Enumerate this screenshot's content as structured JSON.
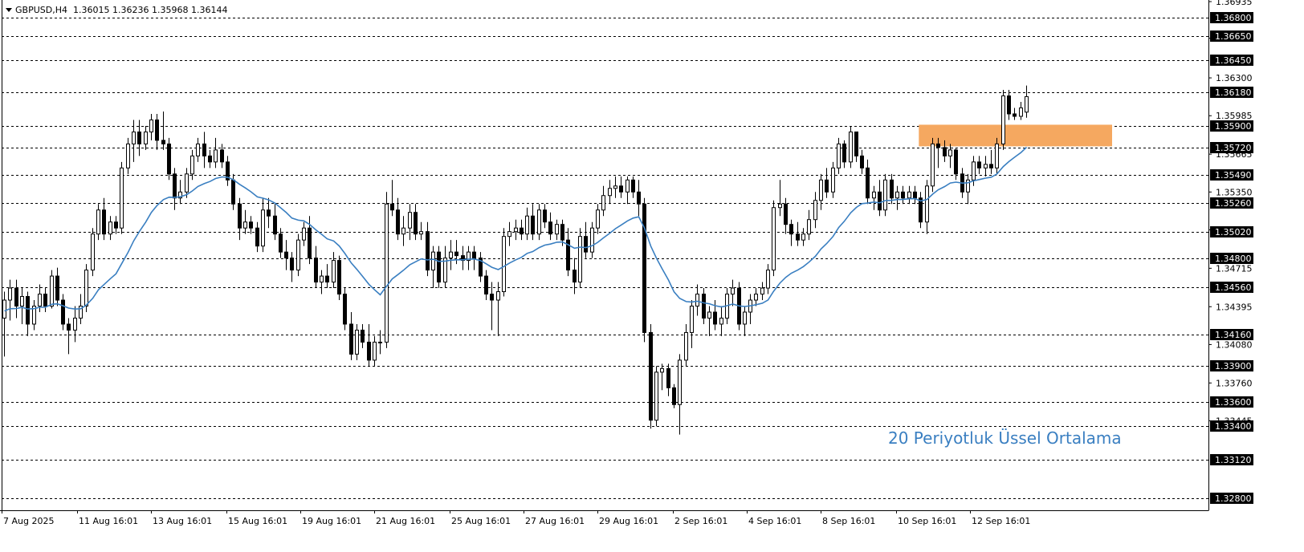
{
  "header": {
    "symbol": "GBPUSD,H4",
    "ohlc": "1.36015 1.36236 1.35968 1.36144"
  },
  "annotation": {
    "ema_label": "20 Periyotluk Üssel Ortalama",
    "ema_color": "#3a7fc1",
    "zone_color": "#f5a860"
  },
  "colors": {
    "background": "#ffffff",
    "candle_up": "#ffffff",
    "candle_down": "#000000",
    "candle_outline": "#000000",
    "level_line": "#000000",
    "price_tag_bg": "#000000",
    "price_tag_text": "#ffffff"
  },
  "chart_data": {
    "type": "candlestick",
    "symbol": "GBPUSD",
    "timeframe": "H4",
    "ylim": [
      1.327,
      1.36935
    ],
    "price_scale_labels": [
      "1.36935",
      "1.36630",
      "1.36300",
      "1.35985",
      "1.35665",
      "1.35350",
      "1.35035",
      "1.34715",
      "1.34395",
      "1.34080",
      "1.33760",
      "1.33445"
    ],
    "horizontal_levels": [
      "1.36800",
      "1.36650",
      "1.36450",
      "1.36180",
      "1.35900",
      "1.35720",
      "1.35490",
      "1.35260",
      "1.35020",
      "1.34800",
      "1.34560",
      "1.34160",
      "1.33900",
      "1.33600",
      "1.33400",
      "1.33120",
      "1.32800"
    ],
    "x_tick_labels": [
      "7 Aug 2025",
      "11 Aug 16:01",
      "13 Aug 16:01",
      "15 Aug 16:01",
      "19 Aug 16:01",
      "21 Aug 16:01",
      "25 Aug 16:01",
      "27 Aug 16:01",
      "29 Aug 16:01",
      "2 Sep 16:01",
      "4 Sep 16:01",
      "8 Sep 16:01",
      "10 Sep 16:01",
      "12 Sep 16:01"
    ],
    "zone": {
      "low": 1.3573,
      "high": 1.3591
    },
    "ema_period": 20,
    "ohlc": [
      [
        1.343,
        1.3452,
        1.3398,
        1.3445
      ],
      [
        1.3445,
        1.3462,
        1.3428,
        1.3455
      ],
      [
        1.3455,
        1.3462,
        1.343,
        1.344
      ],
      [
        1.344,
        1.3455,
        1.3425,
        1.3448
      ],
      [
        1.3448,
        1.3452,
        1.3415,
        1.3425
      ],
      [
        1.3425,
        1.3445,
        1.342,
        1.344
      ],
      [
        1.344,
        1.3458,
        1.3435,
        1.345
      ],
      [
        1.345,
        1.3455,
        1.3435,
        1.344
      ],
      [
        1.344,
        1.347,
        1.3438,
        1.3465
      ],
      [
        1.3465,
        1.3472,
        1.344,
        1.3445
      ],
      [
        1.3445,
        1.345,
        1.342,
        1.3425
      ],
      [
        1.3425,
        1.343,
        1.34,
        1.342
      ],
      [
        1.342,
        1.344,
        1.341,
        1.343
      ],
      [
        1.343,
        1.345,
        1.3425,
        1.344
      ],
      [
        1.344,
        1.3475,
        1.3435,
        1.347
      ],
      [
        1.347,
        1.3505,
        1.3465,
        1.35
      ],
      [
        1.35,
        1.3525,
        1.3495,
        1.352
      ],
      [
        1.352,
        1.353,
        1.3495,
        1.35
      ],
      [
        1.35,
        1.3515,
        1.3495,
        1.351
      ],
      [
        1.351,
        1.3515,
        1.35,
        1.3505
      ],
      [
        1.3505,
        1.356,
        1.35,
        1.3555
      ],
      [
        1.3555,
        1.358,
        1.355,
        1.3575
      ],
      [
        1.3575,
        1.3595,
        1.356,
        1.3585
      ],
      [
        1.3585,
        1.3595,
        1.3565,
        1.3575
      ],
      [
        1.3575,
        1.359,
        1.357,
        1.3585
      ],
      [
        1.3585,
        1.36,
        1.3578,
        1.3595
      ],
      [
        1.3595,
        1.36,
        1.357,
        1.3578
      ],
      [
        1.3578,
        1.3602,
        1.357,
        1.3575
      ],
      [
        1.3575,
        1.358,
        1.3545,
        1.355
      ],
      [
        1.355,
        1.3555,
        1.352,
        1.353
      ],
      [
        1.353,
        1.3545,
        1.3525,
        1.3535
      ],
      [
        1.3535,
        1.3555,
        1.353,
        1.355
      ],
      [
        1.355,
        1.357,
        1.3545,
        1.3565
      ],
      [
        1.3565,
        1.358,
        1.356,
        1.3575
      ],
      [
        1.3575,
        1.3585,
        1.3555,
        1.3565
      ],
      [
        1.3565,
        1.357,
        1.3555,
        1.356
      ],
      [
        1.356,
        1.358,
        1.3555,
        1.357
      ],
      [
        1.357,
        1.3575,
        1.3555,
        1.356
      ],
      [
        1.356,
        1.3565,
        1.354,
        1.3545
      ],
      [
        1.3545,
        1.355,
        1.352,
        1.3525
      ],
      [
        1.3525,
        1.353,
        1.3495,
        1.3505
      ],
      [
        1.3505,
        1.352,
        1.35,
        1.351
      ],
      [
        1.351,
        1.3515,
        1.35,
        1.3505
      ],
      [
        1.3505,
        1.351,
        1.3485,
        1.349
      ],
      [
        1.349,
        1.353,
        1.3485,
        1.352
      ],
      [
        1.352,
        1.353,
        1.3505,
        1.3515
      ],
      [
        1.3515,
        1.3525,
        1.3495,
        1.35
      ],
      [
        1.35,
        1.3505,
        1.348,
        1.3485
      ],
      [
        1.3485,
        1.3495,
        1.347,
        1.348
      ],
      [
        1.348,
        1.3485,
        1.346,
        1.347
      ],
      [
        1.347,
        1.35,
        1.3465,
        1.3495
      ],
      [
        1.3495,
        1.351,
        1.349,
        1.3505
      ],
      [
        1.3505,
        1.3515,
        1.3475,
        1.348
      ],
      [
        1.348,
        1.349,
        1.3455,
        1.346
      ],
      [
        1.346,
        1.347,
        1.345,
        1.3465
      ],
      [
        1.3465,
        1.3475,
        1.3455,
        1.346
      ],
      [
        1.346,
        1.3485,
        1.3455,
        1.3478
      ],
      [
        1.3478,
        1.3482,
        1.3445,
        1.345
      ],
      [
        1.345,
        1.3455,
        1.342,
        1.3425
      ],
      [
        1.3425,
        1.3435,
        1.3395,
        1.34
      ],
      [
        1.34,
        1.3425,
        1.3395,
        1.342
      ],
      [
        1.342,
        1.3425,
        1.3405,
        1.341
      ],
      [
        1.341,
        1.3425,
        1.339,
        1.3395
      ],
      [
        1.3395,
        1.3415,
        1.339,
        1.341
      ],
      [
        1.341,
        1.342,
        1.34,
        1.341
      ],
      [
        1.341,
        1.3535,
        1.3405,
        1.3525
      ],
      [
        1.3525,
        1.3545,
        1.3515,
        1.352
      ],
      [
        1.352,
        1.353,
        1.3495,
        1.35
      ],
      [
        1.35,
        1.3515,
        1.349,
        1.3505
      ],
      [
        1.3505,
        1.3525,
        1.3495,
        1.3518
      ],
      [
        1.3518,
        1.3525,
        1.3495,
        1.35
      ],
      [
        1.35,
        1.351,
        1.3495,
        1.3502
      ],
      [
        1.3502,
        1.351,
        1.3465,
        1.347
      ],
      [
        1.347,
        1.349,
        1.3455,
        1.3485
      ],
      [
        1.3485,
        1.349,
        1.3455,
        1.346
      ],
      [
        1.346,
        1.349,
        1.3455,
        1.348
      ],
      [
        1.348,
        1.3495,
        1.347,
        1.3485
      ],
      [
        1.3485,
        1.3495,
        1.3475,
        1.3482
      ],
      [
        1.3482,
        1.349,
        1.347,
        1.3478
      ],
      [
        1.3478,
        1.349,
        1.347,
        1.3485
      ],
      [
        1.3485,
        1.349,
        1.347,
        1.348
      ],
      [
        1.348,
        1.3485,
        1.346,
        1.3465
      ],
      [
        1.3465,
        1.347,
        1.3445,
        1.345
      ],
      [
        1.345,
        1.346,
        1.342,
        1.3445
      ],
      [
        1.3445,
        1.346,
        1.3415,
        1.3452
      ],
      [
        1.3452,
        1.3505,
        1.3448,
        1.3498
      ],
      [
        1.3498,
        1.351,
        1.349,
        1.3502
      ],
      [
        1.3502,
        1.3512,
        1.3495,
        1.3505
      ],
      [
        1.3505,
        1.3512,
        1.3495,
        1.35
      ],
      [
        1.35,
        1.3522,
        1.3495,
        1.3515
      ],
      [
        1.3515,
        1.3525,
        1.3495,
        1.35
      ],
      [
        1.35,
        1.3525,
        1.3495,
        1.352
      ],
      [
        1.352,
        1.3525,
        1.3505,
        1.351
      ],
      [
        1.351,
        1.3518,
        1.3495,
        1.35
      ],
      [
        1.35,
        1.3512,
        1.3495,
        1.3508
      ],
      [
        1.3508,
        1.3512,
        1.349,
        1.3495
      ],
      [
        1.3495,
        1.3505,
        1.3465,
        1.347
      ],
      [
        1.347,
        1.348,
        1.345,
        1.346
      ],
      [
        1.346,
        1.3505,
        1.3455,
        1.3498
      ],
      [
        1.3498,
        1.351,
        1.348,
        1.3485
      ],
      [
        1.3485,
        1.351,
        1.348,
        1.3505
      ],
      [
        1.3505,
        1.3525,
        1.35,
        1.352
      ],
      [
        1.352,
        1.354,
        1.3515,
        1.3532
      ],
      [
        1.3532,
        1.3545,
        1.3525,
        1.3538
      ],
      [
        1.3538,
        1.3548,
        1.353,
        1.354
      ],
      [
        1.354,
        1.3548,
        1.353,
        1.3535
      ],
      [
        1.3535,
        1.3548,
        1.3525,
        1.3545
      ],
      [
        1.3545,
        1.3548,
        1.353,
        1.3535
      ],
      [
        1.3535,
        1.3545,
        1.3515,
        1.3525
      ],
      [
        1.3525,
        1.353,
        1.341,
        1.3418
      ],
      [
        1.3418,
        1.3425,
        1.3338,
        1.3345
      ],
      [
        1.3345,
        1.339,
        1.334,
        1.3385
      ],
      [
        1.3385,
        1.3392,
        1.337,
        1.3388
      ],
      [
        1.3388,
        1.3392,
        1.3365,
        1.3372
      ],
      [
        1.3372,
        1.3375,
        1.3355,
        1.3358
      ],
      [
        1.3358,
        1.34,
        1.3333,
        1.3395
      ],
      [
        1.3395,
        1.3425,
        1.339,
        1.3418
      ],
      [
        1.3418,
        1.3445,
        1.3405,
        1.344
      ],
      [
        1.344,
        1.3458,
        1.3432,
        1.345
      ],
      [
        1.345,
        1.3455,
        1.3425,
        1.343
      ],
      [
        1.343,
        1.344,
        1.3415,
        1.3435
      ],
      [
        1.3435,
        1.3445,
        1.342,
        1.3425
      ],
      [
        1.3425,
        1.344,
        1.3415,
        1.343
      ],
      [
        1.343,
        1.3455,
        1.3425,
        1.345
      ],
      [
        1.345,
        1.3462,
        1.344,
        1.3455
      ],
      [
        1.3455,
        1.346,
        1.342,
        1.3425
      ],
      [
        1.3425,
        1.344,
        1.3415,
        1.3435
      ],
      [
        1.3435,
        1.345,
        1.3425,
        1.3445
      ],
      [
        1.3445,
        1.3455,
        1.344,
        1.345
      ],
      [
        1.345,
        1.346,
        1.3445,
        1.3455
      ],
      [
        1.3455,
        1.3475,
        1.345,
        1.347
      ],
      [
        1.347,
        1.3528,
        1.3465,
        1.3522
      ],
      [
        1.3522,
        1.3545,
        1.3515,
        1.3525
      ],
      [
        1.3525,
        1.353,
        1.35,
        1.3508
      ],
      [
        1.3508,
        1.3512,
        1.349,
        1.35
      ],
      [
        1.35,
        1.351,
        1.349,
        1.3495
      ],
      [
        1.3495,
        1.3505,
        1.349,
        1.35
      ],
      [
        1.35,
        1.352,
        1.3495,
        1.3512
      ],
      [
        1.3512,
        1.3535,
        1.3505,
        1.3528
      ],
      [
        1.3528,
        1.355,
        1.352,
        1.3545
      ],
      [
        1.3545,
        1.3555,
        1.353,
        1.3535
      ],
      [
        1.3535,
        1.356,
        1.353,
        1.3555
      ],
      [
        1.3555,
        1.358,
        1.355,
        1.3575
      ],
      [
        1.3575,
        1.3578,
        1.3555,
        1.356
      ],
      [
        1.356,
        1.359,
        1.3555,
        1.3585
      ],
      [
        1.3585,
        1.3585,
        1.356,
        1.3565
      ],
      [
        1.3565,
        1.357,
        1.355,
        1.3555
      ],
      [
        1.3555,
        1.3562,
        1.3525,
        1.353
      ],
      [
        1.353,
        1.354,
        1.352,
        1.3535
      ],
      [
        1.3535,
        1.3545,
        1.3515,
        1.352
      ],
      [
        1.352,
        1.355,
        1.3515,
        1.3545
      ],
      [
        1.3545,
        1.355,
        1.3525,
        1.353
      ],
      [
        1.353,
        1.354,
        1.352,
        1.3535
      ],
      [
        1.3535,
        1.354,
        1.3525,
        1.353
      ],
      [
        1.353,
        1.354,
        1.3525,
        1.3535
      ],
      [
        1.3535,
        1.354,
        1.3525,
        1.353
      ],
      [
        1.353,
        1.3535,
        1.3505,
        1.351
      ],
      [
        1.351,
        1.3545,
        1.35,
        1.354
      ],
      [
        1.354,
        1.358,
        1.3535,
        1.3575
      ],
      [
        1.3575,
        1.358,
        1.3555,
        1.3572
      ],
      [
        1.3572,
        1.3578,
        1.356,
        1.3565
      ],
      [
        1.3565,
        1.3575,
        1.3555,
        1.357
      ],
      [
        1.357,
        1.3572,
        1.3545,
        1.355
      ],
      [
        1.355,
        1.3555,
        1.353,
        1.3535
      ],
      [
        1.3535,
        1.355,
        1.3525,
        1.3545
      ],
      [
        1.3545,
        1.3565,
        1.354,
        1.356
      ],
      [
        1.356,
        1.3565,
        1.355,
        1.3555
      ],
      [
        1.3555,
        1.3565,
        1.3548,
        1.3558
      ],
      [
        1.3558,
        1.357,
        1.355,
        1.3555
      ],
      [
        1.3555,
        1.358,
        1.355,
        1.3575
      ],
      [
        1.3575,
        1.362,
        1.357,
        1.3615
      ],
      [
        1.3615,
        1.362,
        1.3595,
        1.36
      ],
      [
        1.36,
        1.3605,
        1.3595,
        1.3598
      ],
      [
        1.3598,
        1.361,
        1.3595,
        1.3605
      ],
      [
        1.36015,
        1.36236,
        1.35968,
        1.36144
      ]
    ]
  }
}
